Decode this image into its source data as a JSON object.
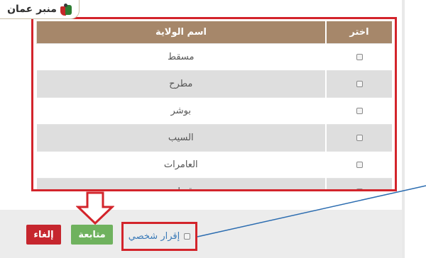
{
  "logo": {
    "text": "منبر عمان"
  },
  "table": {
    "headers": {
      "select": "اختر",
      "name": "اسم الولاية"
    },
    "rows": [
      {
        "name": "مسقط"
      },
      {
        "name": "مطرح"
      },
      {
        "name": "بوشر"
      },
      {
        "name": "السيب"
      },
      {
        "name": "العامرات"
      },
      {
        "name": "قريات"
      }
    ]
  },
  "actions": {
    "cancel_label": "إلغاء",
    "continue_label": "متابعة",
    "acknowledgement_label": "إقرار شخصي"
  },
  "colors": {
    "header_bg": "#a6876a",
    "highlight": "#d3242b",
    "cancel": "#c6262e",
    "continue": "#6fb25e",
    "link_text": "#3a7ab8"
  }
}
